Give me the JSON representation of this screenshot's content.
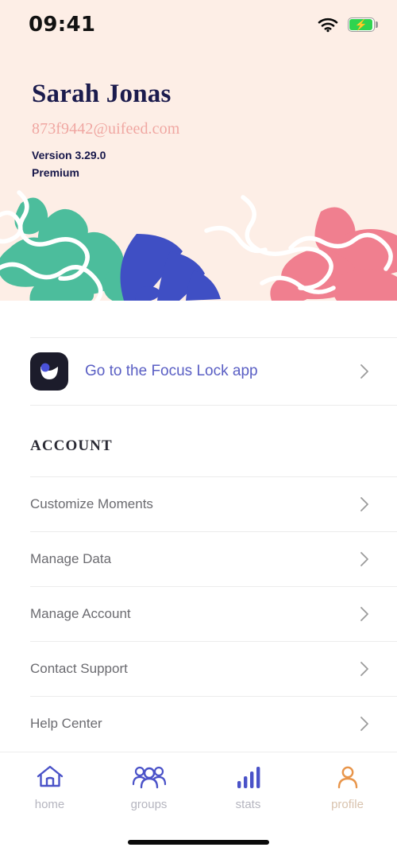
{
  "status_bar": {
    "time": "09:41",
    "wifi_icon": "wifi-icon",
    "battery_icon": "battery-charging-icon"
  },
  "header": {
    "user_name": "Sarah Jonas",
    "user_email": "873f9442@uifeed.com",
    "version": "Version 3.29.0",
    "plan": "Premium",
    "background_color": "#fdeee6",
    "decor_colors": {
      "teal": "#4cbd9c",
      "blue": "#3f4fc4",
      "pink": "#f07f8f",
      "squiggle": "#ffffff"
    }
  },
  "focus_link": {
    "label": "Go to the Focus Lock app",
    "icon": "focus-lock-app-icon",
    "chevron": "chevron-right-icon",
    "label_color": "#5a5fc4"
  },
  "account_section": {
    "title": "ACCOUNT",
    "items": [
      {
        "label": "Customize Moments",
        "chevron": "chevron-right-icon"
      },
      {
        "label": "Manage Data",
        "chevron": "chevron-right-icon"
      },
      {
        "label": "Manage Account",
        "chevron": "chevron-right-icon"
      },
      {
        "label": "Contact Support",
        "chevron": "chevron-right-icon"
      },
      {
        "label": "Help Center",
        "chevron": "chevron-right-icon"
      }
    ]
  },
  "tab_bar": {
    "active": "profile",
    "active_color": "#e8954a",
    "inactive_color": "#4a52c8",
    "items": [
      {
        "label": "home",
        "icon": "home-icon"
      },
      {
        "label": "groups",
        "icon": "groups-icon"
      },
      {
        "label": "stats",
        "icon": "bar-chart-icon"
      },
      {
        "label": "profile",
        "icon": "person-icon"
      }
    ]
  }
}
